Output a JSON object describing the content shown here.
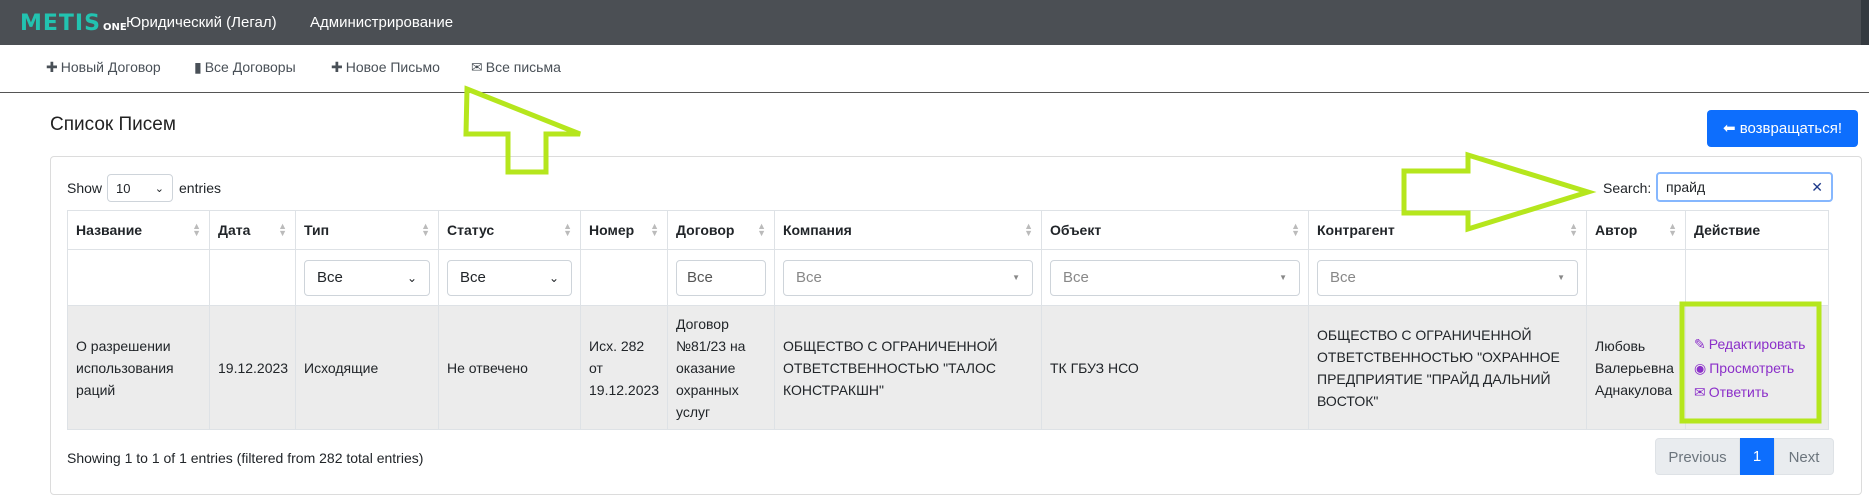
{
  "brand": {
    "logo_text": "METIS",
    "logo_sub": "ONE",
    "logo_color": "#22c3b0"
  },
  "topnav": {
    "items": [
      "Юридический (Легал)",
      "Администрирование"
    ]
  },
  "subnav": {
    "items": [
      {
        "icon": "plus-icon",
        "label": "Новый Договор"
      },
      {
        "icon": "book-icon",
        "label": "Все Договоры"
      },
      {
        "icon": "plus-icon",
        "label": "Новое Письмо"
      },
      {
        "icon": "envelope-icon",
        "label": "Все письма"
      }
    ]
  },
  "page": {
    "title": "Список Писем",
    "back_button": "возвращаться!"
  },
  "table_controls": {
    "show_label": "Show",
    "page_size": "10",
    "entries_label": "entries",
    "search_label": "Search:",
    "search_value": "прайд"
  },
  "table": {
    "headers": [
      "Название",
      "Дата",
      "Тип",
      "Статус",
      "Номер",
      "Договор",
      "Компания",
      "Объект",
      "Контрагент",
      "Автор",
      "Действие"
    ],
    "filters": {
      "type": "Все",
      "status": "Все",
      "contract": "Все",
      "company": "Все",
      "object": "Все",
      "counterparty": "Все"
    },
    "rows": [
      {
        "name": "О разрешении использования раций",
        "date": "19.12.2023",
        "type": "Исходящие",
        "status": "Не отвечено",
        "number": "Исх. 282 от 19.12.2023",
        "contract": "Договор №81/23 на оказание охранных услуг",
        "company": "ОБЩЕСТВО С ОГРАНИЧЕННОЙ ОТВЕТСТВЕННОСТЬЮ \"ТАЛОС КОНСТРАКШН\"",
        "object": "ТК ГБУЗ НСО",
        "counterparty": "ОБЩЕСТВО С ОГРАНИЧЕННОЙ ОТВЕТСТВЕННОСТЬЮ \"ОХРАННОЕ ПРЕДПРИЯТИЕ \"ПРАЙД ДАЛЬНИЙ ВОСТОК\"",
        "author": "Любовь Валерьевна Аднакулова",
        "actions": {
          "edit": "Редактировать",
          "view": "Просмотреть",
          "reply": "Ответить"
        }
      }
    ]
  },
  "footer": {
    "info": "Showing 1 to 1 of 1 entries (filtered from 282 total entries)",
    "prev": "Previous",
    "current_page": "1",
    "next": "Next"
  },
  "colors": {
    "topbar": "#4b4f54",
    "primary": "#0d6efd",
    "action_link": "#8b2fc9",
    "annotation": "#b5e61d"
  }
}
